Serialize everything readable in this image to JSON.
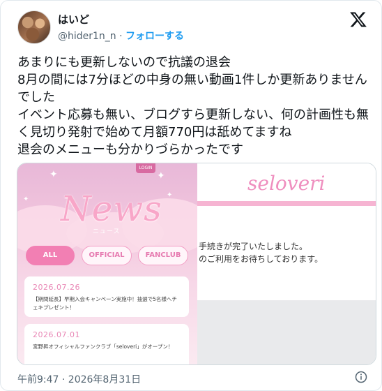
{
  "tweet": {
    "display_name": "はいど",
    "handle": "@hider1n_n",
    "separator": "·",
    "follow_label": "フォローする",
    "text": "あまりにも更新しないので抗議の退会\n8月の間には7分ほどの中身の無い動画1件しか更新ありませんでした\nイベント応募も無い、ブログすら更新しない、何の計画性も無く見切り発射で始めて月額770円は舐めてますね\n退会のメニューも分かりづらかったです",
    "timestamp": "午前9:47 · 2026年8月31日"
  },
  "media_left": {
    "login_label": "LOGIN",
    "title": "News",
    "subtitle": "ニュース",
    "tabs": [
      {
        "label": "ALL",
        "active": true
      },
      {
        "label": "OFFICIAL",
        "active": false
      },
      {
        "label": "FANCLUB",
        "active": false
      }
    ],
    "news": [
      {
        "date": "2026.07.26",
        "body": "【期間延長】早期入会キャンペーン実施中！抽選で5名様へチェキプレゼント！"
      },
      {
        "date": "2026.07.01",
        "body": "宮野昇オフィシャルファンクラブ「seloveri」がオープン！"
      }
    ]
  },
  "media_right": {
    "logo": "seloveri",
    "messages": [
      "手続きが完了いたしました。",
      "のご利用をお待ちしております。"
    ]
  },
  "colors": {
    "accent": "#1d9bf0",
    "pink": "#f27fb3"
  },
  "icons": {
    "brand": "x-logo-icon",
    "info": "info-icon"
  }
}
